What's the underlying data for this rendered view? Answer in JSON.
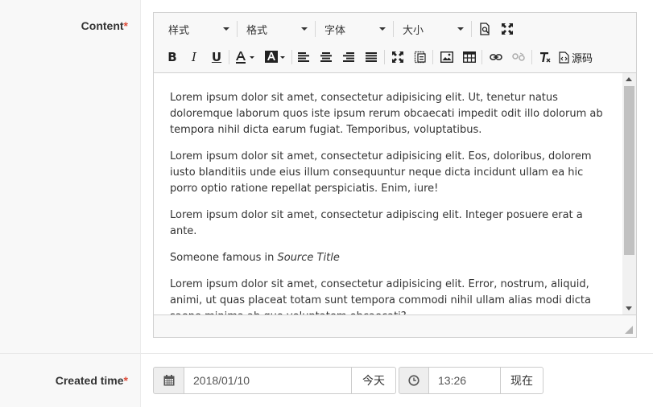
{
  "form": {
    "content_label": "Content",
    "created_label": "Created time",
    "required_mark": "*"
  },
  "toolbar": {
    "styles": "样式",
    "format": "格式",
    "font": "字体",
    "size": "大小",
    "source_label": "源码"
  },
  "content": {
    "p1": "Lorem ipsum dolor sit amet, consectetur adipisicing elit. Ut, tenetur natus doloremque laborum quos iste ipsum rerum obcaecati impedit odit illo dolorum ab tempora nihil dicta earum fugiat. Temporibus, voluptatibus.",
    "p2": "Lorem ipsum dolor sit amet, consectetur adipisicing elit. Eos, doloribus, dolorem iusto blanditiis unde eius illum consequuntur neque dicta incidunt ullam ea hic porro optio ratione repellat perspiciatis. Enim, iure!",
    "p3": "Lorem ipsum dolor sit amet, consectetur adipiscing elit. Integer posuere erat a ante.",
    "p4_prefix": "Someone famous in ",
    "p4_cite": "Source Title",
    "p5": "Lorem ipsum dolor sit amet, consectetur adipisicing elit. Error, nostrum, aliquid, animi, ut quas placeat totam sunt tempora commodi nihil ullam alias modi dicta saepe minima ab quo voluptatem obcaecati?"
  },
  "datetime": {
    "date_value": "2018/01/10",
    "today_button": "今天",
    "time_value": "13:26",
    "now_button": "现在"
  }
}
